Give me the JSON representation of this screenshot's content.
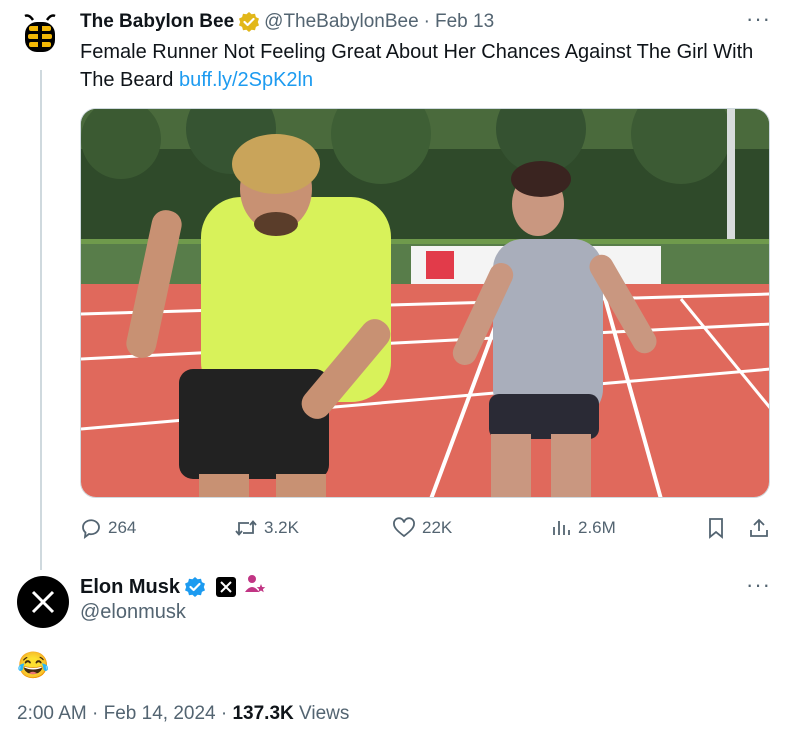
{
  "quoted_tweet": {
    "author_name": "The Babylon Bee",
    "author_handle": "@TheBabylonBee",
    "separator": "·",
    "date": "Feb 13",
    "text": "Female Runner Not Feeling Great About Her Chances Against The Girl With The Beard",
    "link": "buff.ly/2SpK2ln",
    "media_icon": "photo-track-runners",
    "actions": {
      "replies": "264",
      "retweets": "3.2K",
      "likes": "22K",
      "views": "2.6M"
    }
  },
  "reply": {
    "author_name": "Elon Musk",
    "author_handle": "@elonmusk",
    "text": "😂",
    "time": "2:00 AM",
    "date": "Feb 14, 2024",
    "separator": "·",
    "views_count": "137.3K",
    "views_label": "Views"
  },
  "icons": {
    "more": "···",
    "verified_gold": "verified-gold-icon",
    "verified_blue": "verified-blue-icon"
  },
  "colors": {
    "link": "#1d9bf0",
    "muted": "#536471",
    "gold": "#e2b719",
    "blue": "#1d9bf0",
    "track": "#e0695c"
  }
}
